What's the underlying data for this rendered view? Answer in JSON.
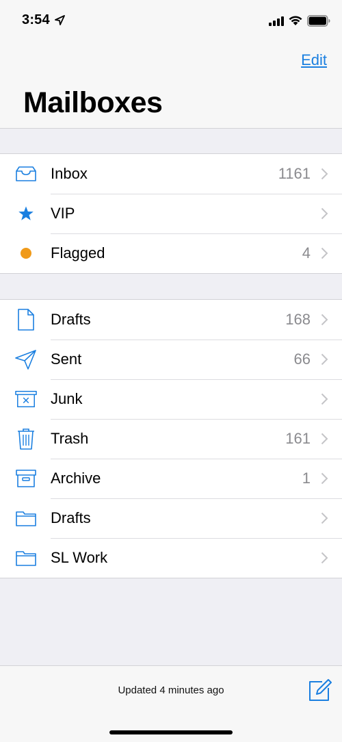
{
  "status_bar": {
    "time": "3:54"
  },
  "header": {
    "edit_label": "Edit",
    "title": "Mailboxes"
  },
  "group1": [
    {
      "label": "Inbox",
      "count": "1161",
      "icon": "inbox-tray-icon"
    },
    {
      "label": "VIP",
      "count": "",
      "icon": "star-icon"
    },
    {
      "label": "Flagged",
      "count": "4",
      "icon": "flag-dot-icon"
    }
  ],
  "group2": [
    {
      "label": "Drafts",
      "count": "168",
      "icon": "document-icon"
    },
    {
      "label": "Sent",
      "count": "66",
      "icon": "paper-plane-icon"
    },
    {
      "label": "Junk",
      "count": "",
      "icon": "junk-bin-icon"
    },
    {
      "label": "Trash",
      "count": "161",
      "icon": "trash-icon"
    },
    {
      "label": "Archive",
      "count": "1",
      "icon": "archive-box-icon"
    },
    {
      "label": "Drafts",
      "count": "",
      "icon": "folder-icon"
    },
    {
      "label": "SL Work",
      "count": "",
      "icon": "folder-icon"
    }
  ],
  "toolbar": {
    "status_text": "Updated 4 minutes ago"
  },
  "colors": {
    "accent": "#1a7fe0",
    "flag": "#f09a1a",
    "star": "#1a7fe0"
  }
}
